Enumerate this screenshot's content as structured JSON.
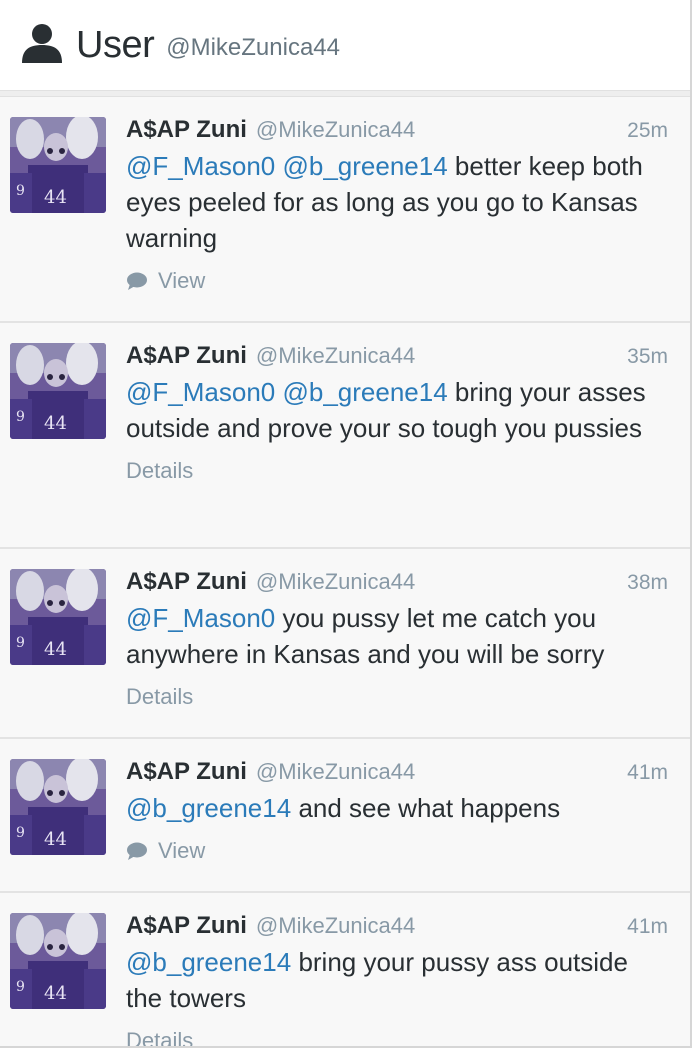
{
  "header": {
    "title": "User",
    "handle": "@MikeZunica44"
  },
  "tweets": [
    {
      "name": "A$AP Zuni",
      "username": "@MikeZunica44",
      "time": "25m",
      "mentions": [
        "@F_Mason0",
        "@b_greene14"
      ],
      "line1_rest": "better keep",
      "rest": "both eyes peeled for as long as you go to Kansas warning",
      "action": "View",
      "action_icon": "comment-icon"
    },
    {
      "name": "A$AP Zuni",
      "username": "@MikeZunica44",
      "time": "35m",
      "mentions": [
        "@F_Mason0",
        "@b_greene14"
      ],
      "line1_rest": "bring your",
      "rest": "asses outside and prove your so tough you pussies",
      "action": "Details"
    },
    {
      "name": "A$AP Zuni",
      "username": "@MikeZunica44",
      "time": "38m",
      "mentions": [
        "@F_Mason0"
      ],
      "line1_rest": "you pussy let me catch you",
      "rest": "anywhere in Kansas and you will be sorry",
      "action": "Details"
    },
    {
      "name": "A$AP Zuni",
      "username": "@MikeZunica44",
      "time": "41m",
      "mentions": [
        "@b_greene14"
      ],
      "line1_rest": "and see what happens",
      "rest": "",
      "action": "View",
      "action_icon": "comment-icon"
    },
    {
      "name": "A$AP Zuni",
      "username": "@MikeZunica44",
      "time": "41m",
      "mentions": [
        "@b_greene14"
      ],
      "line1_rest": "bring your pussy ass outside",
      "rest": "the towers",
      "action": "Details"
    }
  ],
  "colors": {
    "mention": "#2b7bb9",
    "meta": "#8899a6",
    "text": "#292f33",
    "tweet_bg": "#f8f8f8"
  }
}
